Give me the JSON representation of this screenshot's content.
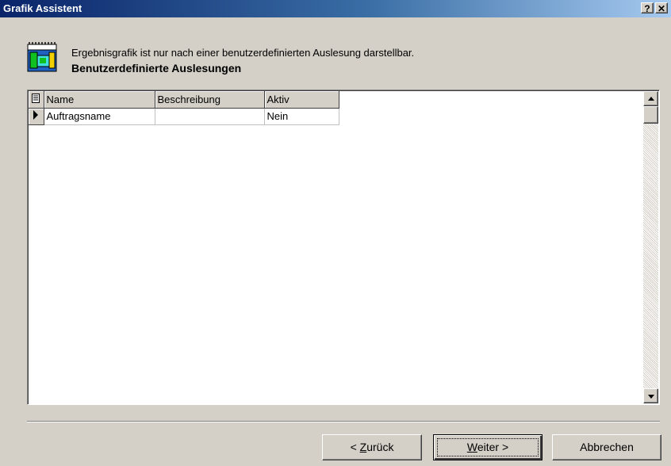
{
  "window": {
    "title": "Grafik Assistent",
    "help_label": "?",
    "close_label": "✕"
  },
  "header": {
    "message": "Ergebnisgrafik ist nur nach einer benutzerdefinierten Auslesung darstellbar.",
    "title": "Benutzerdefinierte Auslesungen",
    "icon": "wizard-chart-icon"
  },
  "grid": {
    "columns": [
      "Name",
      "Beschreibung",
      "Aktiv"
    ],
    "rows": [
      {
        "name": "Auftragsname",
        "description": "",
        "active": "Nein"
      }
    ]
  },
  "buttons": {
    "back": {
      "prefix": "< ",
      "mnemonic": "Z",
      "rest": "urück"
    },
    "next": {
      "mnemonic": "W",
      "rest": "eiter >"
    },
    "cancel": "Abbrechen"
  },
  "colors": {
    "title_start": "#0a246a",
    "title_end": "#a6caf0",
    "dialog_bg": "#d4d0c8"
  }
}
